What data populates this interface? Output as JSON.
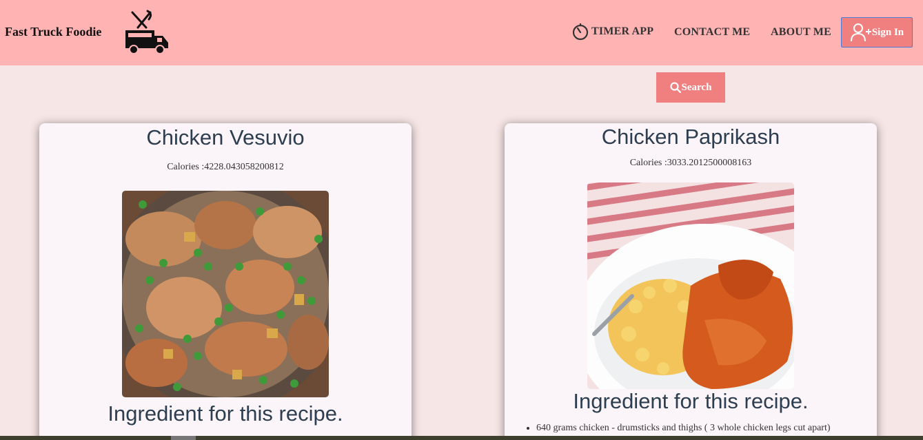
{
  "nav": {
    "brand": "Fast Truck Foodie",
    "links": {
      "timer": "TIMER APP",
      "contact": "CONTACT ME",
      "about": "ABOUT ME"
    },
    "signin_label": "Sign In"
  },
  "search": {
    "label": "Search"
  },
  "recipes": [
    {
      "title": "Chicken Vesuvio",
      "calories": "Calories :4228.043058200812",
      "ingredient_heading": "Ingredient for this recipe.",
      "ingredients": []
    },
    {
      "title": "Chicken Paprikash",
      "calories": "Calories :3033.2012500008163",
      "ingredient_heading": "Ingredient for this recipe.",
      "ingredients": [
        "640 grams chicken - drumsticks and thighs ( 3 whole chicken legs cut apart)"
      ]
    }
  ],
  "colors": {
    "navbar": "#ffb3b3",
    "background": "#f7e6e6",
    "button": "#f08080",
    "card": "#fbf4f8"
  }
}
